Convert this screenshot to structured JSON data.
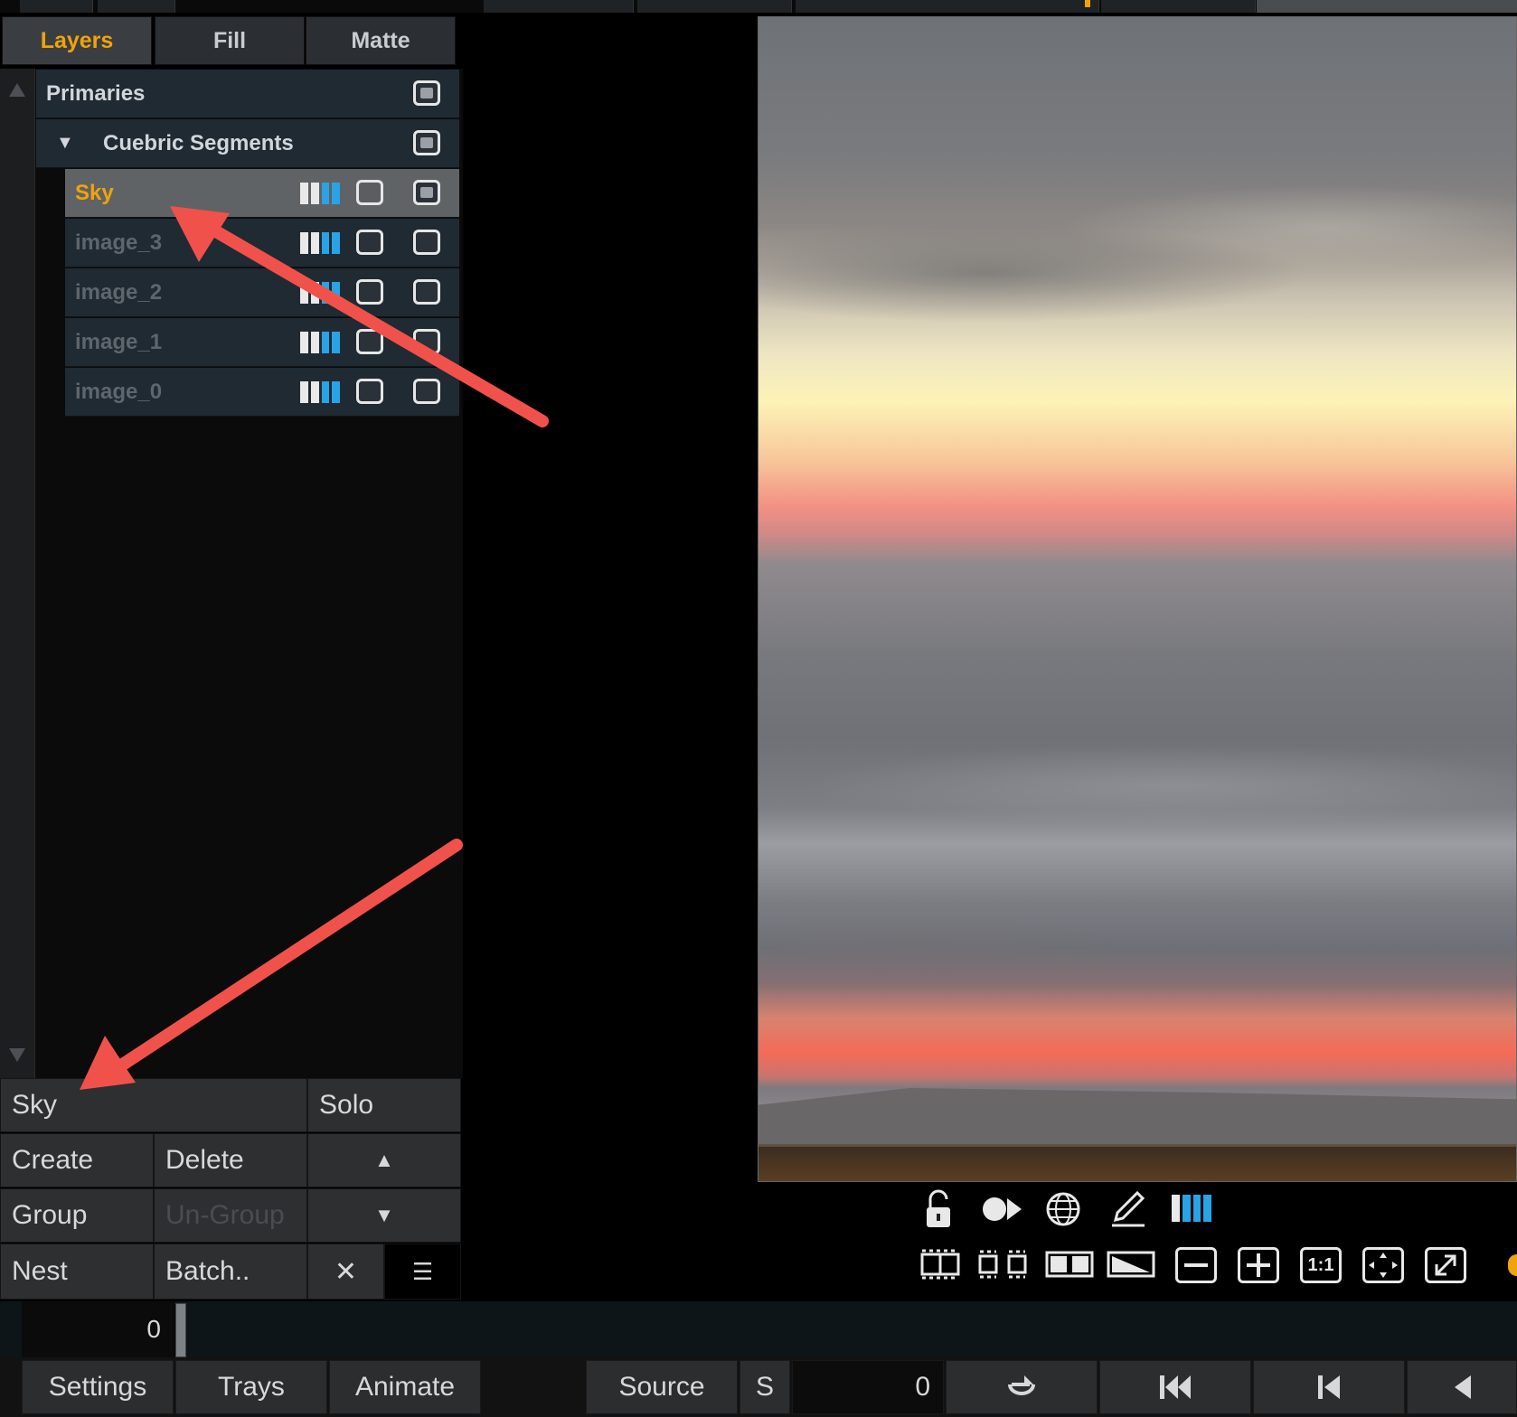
{
  "tabs": [
    {
      "label": "Layers",
      "active": true
    },
    {
      "label": "Fill",
      "active": false
    },
    {
      "label": "Matte",
      "active": false
    }
  ],
  "layers": {
    "primaries": "Primaries",
    "group": "Cuebric Segments",
    "items": [
      {
        "label": "Sky",
        "selected": true
      },
      {
        "label": "image_3",
        "selected": false
      },
      {
        "label": "image_2",
        "selected": false
      },
      {
        "label": "image_1",
        "selected": false
      },
      {
        "label": "image_0",
        "selected": false
      }
    ]
  },
  "controls": {
    "layer_name": "Sky",
    "solo": "Solo",
    "create": "Create",
    "delete": "Delete",
    "group": "Group",
    "ungroup": "Un-Group",
    "nest": "Nest",
    "batch": "Batch..",
    "close_symbol": "✕",
    "up_symbol": "▲",
    "down_symbol": "▼",
    "menu_symbol": "☰"
  },
  "viewer_toolbar": {
    "zoom_1to1": "1:1"
  },
  "timeline": {
    "frame": "0"
  },
  "bottom_bar": {
    "settings": "Settings",
    "trays": "Trays",
    "animate": "Animate",
    "source": "Source",
    "s": "S",
    "frame_value": "0"
  },
  "colors": {
    "accent": "#f0a30a",
    "row_bg": "#1f2a33",
    "selected_row_bg": "#5f6366",
    "annotation_arrow": "#f0524b",
    "color_bar_blue": "#2aa2e6"
  }
}
